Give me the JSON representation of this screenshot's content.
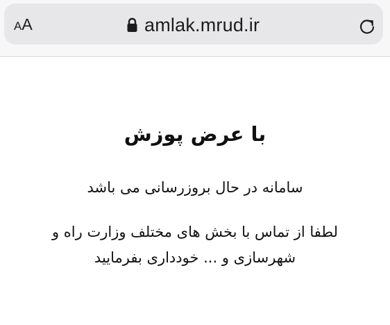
{
  "browser": {
    "text_size_small": "A",
    "text_size_big": "A",
    "url": "amlak.mrud.ir",
    "icons": {
      "lock": "lock-icon",
      "reload": "reload-icon"
    }
  },
  "page": {
    "title": "با عرض پوزش",
    "message_line_1": "سامانه در حال بروزرسانی می باشد",
    "message_line_2": "لطفا از تماس با بخش های مختلف وزارت راه و",
    "message_line_3": "شهرسازی و ... خودداری بفرمایید"
  }
}
